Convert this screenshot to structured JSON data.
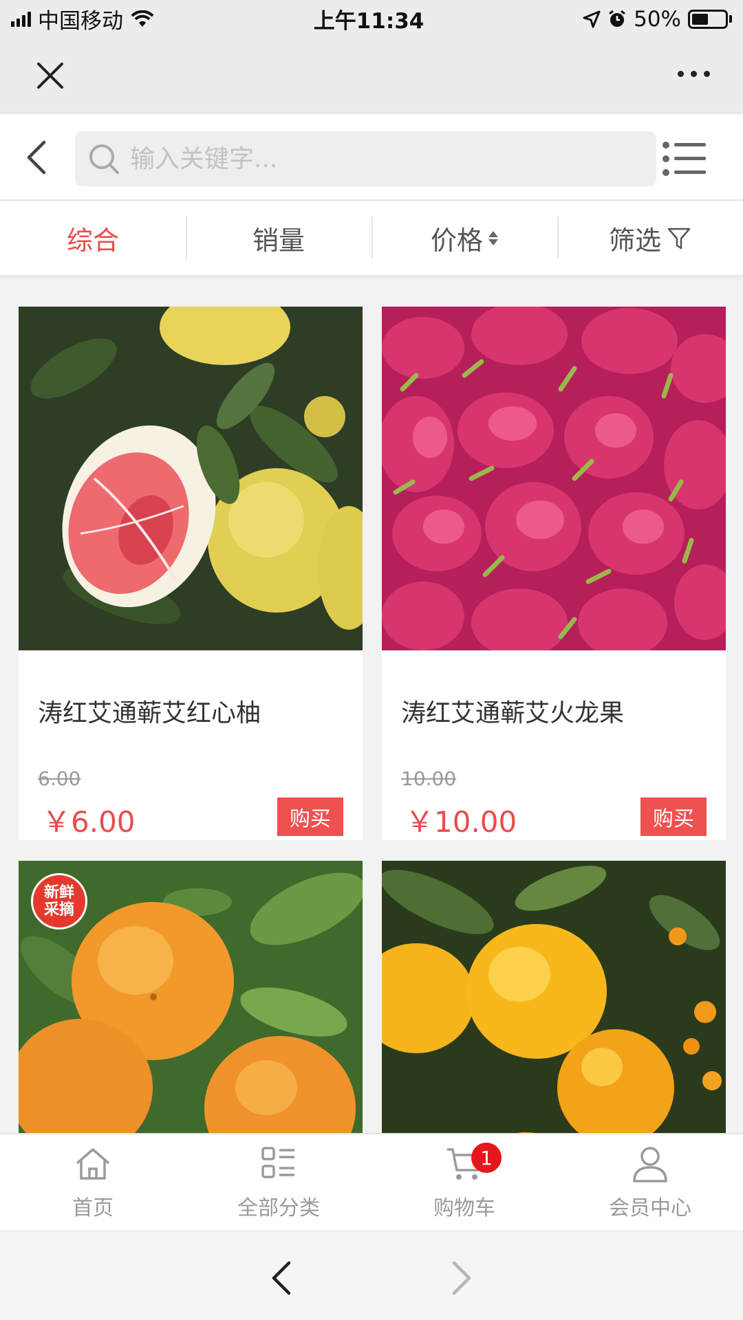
{
  "status_bar": {
    "carrier": "中国移动",
    "time": "上午11:34",
    "battery": "50%",
    "icons": [
      "signal-icon",
      "wifi-icon",
      "location-icon",
      "alarm-icon",
      "battery-icon"
    ]
  },
  "top_bar": {
    "icons": [
      "close-icon",
      "more-icon"
    ]
  },
  "search": {
    "placeholder": "输入关键字..."
  },
  "sort_tabs": [
    {
      "label": "综合",
      "active": true
    },
    {
      "label": "销量",
      "active": false
    },
    {
      "label": "价格",
      "active": false
    },
    {
      "label": "筛选",
      "active": false
    }
  ],
  "products": [
    {
      "title": "涛红艾通蕲艾红心柚",
      "old_price": "6.00",
      "price": "￥6.00",
      "buy_label": "购买"
    },
    {
      "title": "涛红艾通蕲艾火龙果",
      "old_price": "10.00",
      "price": "￥10.00",
      "buy_label": "购买"
    },
    {
      "title": "",
      "old_price": "",
      "price": "",
      "buy_label": "",
      "badge": [
        "新鲜",
        "采摘"
      ]
    },
    {
      "title": "",
      "old_price": "",
      "price": "",
      "buy_label": ""
    }
  ],
  "tab_bar": [
    {
      "label": "首页",
      "icon": "home-icon"
    },
    {
      "label": "全部分类",
      "icon": "category-icon"
    },
    {
      "label": "购物车",
      "icon": "cart-icon",
      "badge": "1"
    },
    {
      "label": "会员中心",
      "icon": "user-icon"
    }
  ],
  "colors": {
    "accent": "#e94c4c",
    "buy_button": "#ef5050",
    "badge": "#e8151b",
    "tab_inactive": "#9a9a9a"
  }
}
